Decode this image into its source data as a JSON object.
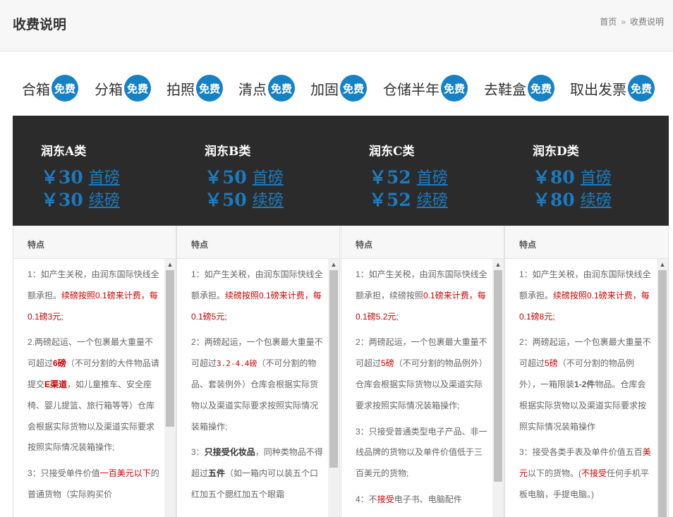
{
  "header": {
    "title": "收费说明",
    "crumb_home": "首页",
    "crumb_sep": "»",
    "crumb_current": "收费说明"
  },
  "services": [
    {
      "name": "合箱",
      "badge": "免费"
    },
    {
      "name": "分箱",
      "badge": "免费"
    },
    {
      "name": "拍照",
      "badge": "免费"
    },
    {
      "name": "清点",
      "badge": "免费"
    },
    {
      "name": "加固",
      "badge": "免费"
    },
    {
      "name": "仓储半年",
      "badge": "免费"
    },
    {
      "name": "去鞋盒",
      "badge": "免费"
    },
    {
      "name": "取出发票",
      "badge": "免费"
    }
  ],
  "plans": [
    {
      "name": "润东A类",
      "first_price": "￥30",
      "first_label": "首磅",
      "cont_price": "￥30",
      "cont_label": "续磅"
    },
    {
      "name": "润东B类",
      "first_price": "￥50",
      "first_label": "首磅",
      "cont_price": "￥50",
      "cont_label": "续磅"
    },
    {
      "name": "润东C类",
      "first_price": "￥52",
      "first_label": "首磅",
      "cont_price": "￥52",
      "cont_label": "续磅"
    },
    {
      "name": "润东D类",
      "first_price": "￥80",
      "first_label": "首磅",
      "cont_price": "￥80",
      "cont_label": "续磅"
    }
  ],
  "features": {
    "heading": "特点",
    "a": {
      "p1_a": "1：如产生关税，由润东国际快线全额承担。",
      "p1_red": "续磅按照0.1磅来计费，每0.1磅3元;",
      "p2_a": "2.两磅起运、一个包裹最大重量不可超过",
      "p2_red1": "6磅",
      "p2_b": "（不可分割的大件物品请提交",
      "p2_red2": "E渠道",
      "p2_c": "，如儿童推车、安全座椅、婴儿提篮、旅行箱等等）仓库会根据实际货物以及渠道实际要求按照实际情况装箱操作;",
      "p3_a": "3：只接受单件价值",
      "p3_red": "一百美元以下",
      "p3_b": "的普通货物（实际购买价"
    },
    "b": {
      "p1_a": "1：如产生关税，由润东国际快线全额承担。",
      "p1_red": "续磅按照0.1磅来计费，每0.1磅5元;",
      "p2_a": "2：两磅起运，一个包裹最大重量不可超过",
      "p2_red": "3.2-4.4磅",
      "p2_b": "（不可分割的物品、套装例外）仓库会根据实际货物以及渠道实际要求按照实际情况装箱操作;",
      "p3_a": "3：",
      "p3_bold": "只接受化妆品",
      "p3_b": "，同种类物品不得超过",
      "p3_bold2": "五件",
      "p3_c": "（如一箱内可以装五个口红加五个腮红加五个眼霜"
    },
    "c": {
      "p1_a": "1：如产生关税，由润东国际快线全额承担，续磅按照",
      "p1_red": "0.1磅来计费，每0.1磅5.2元;",
      "p2_a": "2：两磅起运，一个包裹最大重量不可超过",
      "p2_red": "5磅",
      "p2_b": "（不可分割的物品例外）仓库会根据实际货物以及渠道实际要求按照实际情况装箱操作;",
      "p3_a": "3：只接受普通类型电子产品、非一线品牌的货物以及单件价值低于三百美元的货物;",
      "p4_a": "4：不",
      "p4_red": "接受",
      "p4_b": "电子书、电脑配件"
    },
    "d": {
      "p1_a": "1：如产生关税，由润东国际快线全额承担。",
      "p1_red": "续磅按照0.1磅来计费，每0.1磅8元;",
      "p2_a": "2：两磅起运，一个包裹最大重量不可超过",
      "p2_red": "5磅",
      "p2_b": "（不可分割的物品例外），一箱限装",
      "p2_bold": "1-2件",
      "p2_c": "物品。仓库会根据实际货物以及渠道实际要求按照实际情况装箱操作",
      "p3_a": "3：接受各类手表及单件价值五百",
      "p3_red": "美元",
      "p3_b": "以下的货物。(",
      "p3_red2": "不接受",
      "p3_c": "任何手机平板电脑，手提电脑。)"
    }
  },
  "colors": {
    "badge": "#1682c5",
    "price": "#1b7bc0",
    "band": "#2b2b2b",
    "highlight": "#cc0000"
  }
}
